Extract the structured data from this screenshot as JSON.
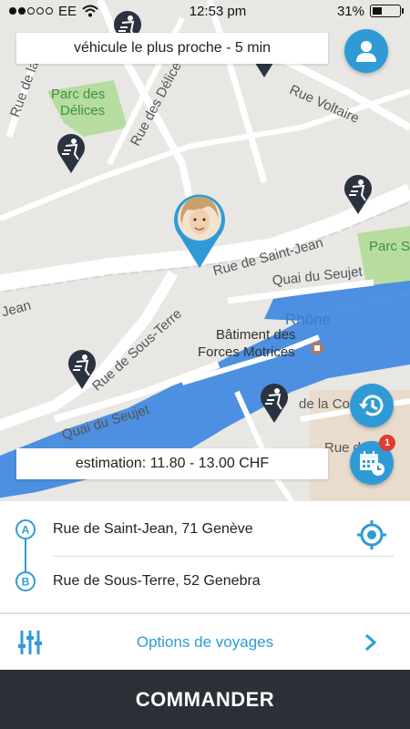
{
  "status_bar": {
    "carrier": "EE",
    "time": "12:53 pm",
    "battery": "31%",
    "battery_level": 0.31,
    "signal_bars_filled": 2,
    "signal_bars_total": 5
  },
  "map": {
    "labels": {
      "parc_des_delices": "Parc des Délices",
      "parc_des_delices_l1": "Parc des",
      "parc_des_delices_l2": "Délices",
      "rue_des_delices": "Rue des Délices",
      "rue_voltaire": "Rue Voltaire",
      "rue_de_la": "Rue de la",
      "rue_de_saint_jean": "Rue de Saint-Jean",
      "parc_s": "Parc S",
      "quai_du_seujet_top": "Quai du Seujet",
      "jean": "Jean",
      "rhone": "Rhône",
      "batiment_l1": "Bâtiment des",
      "batiment_l2": "Forces Motrices",
      "rue_de_sous_terre": "Rue de Sous-Terre",
      "quai_du_seujet_bottom": "Quai du Seujet",
      "de_la_cou": "de la Cou",
      "rue_de_l": "Rue de l"
    },
    "top_banner": "véhicule le plus proche - 5 min",
    "bottom_banner": "estimation: 11.80 - 13.00 CHF",
    "notification_count": "1"
  },
  "route": {
    "origin_marker": "A",
    "origin": "Rue de Saint-Jean, 71 Genève",
    "destination_marker": "B",
    "destination": "Rue de Sous-Terre, 52 Genebra"
  },
  "options": {
    "label": "Options de voyages"
  },
  "order_button": {
    "label": "COMMANDER"
  },
  "colors": {
    "accent": "#2f9bd6",
    "dark_bar": "#2b3037",
    "water": "#4d8fe0",
    "park": "#b7dca0",
    "badge": "#e23a2e"
  },
  "icons": {
    "profile": "user-icon",
    "history": "history-icon",
    "calendar": "calendar-clock-icon",
    "locate": "crosshair-icon",
    "options": "sliders-icon",
    "chevron": "chevron-right-icon",
    "driver": "driver-pin-icon"
  }
}
